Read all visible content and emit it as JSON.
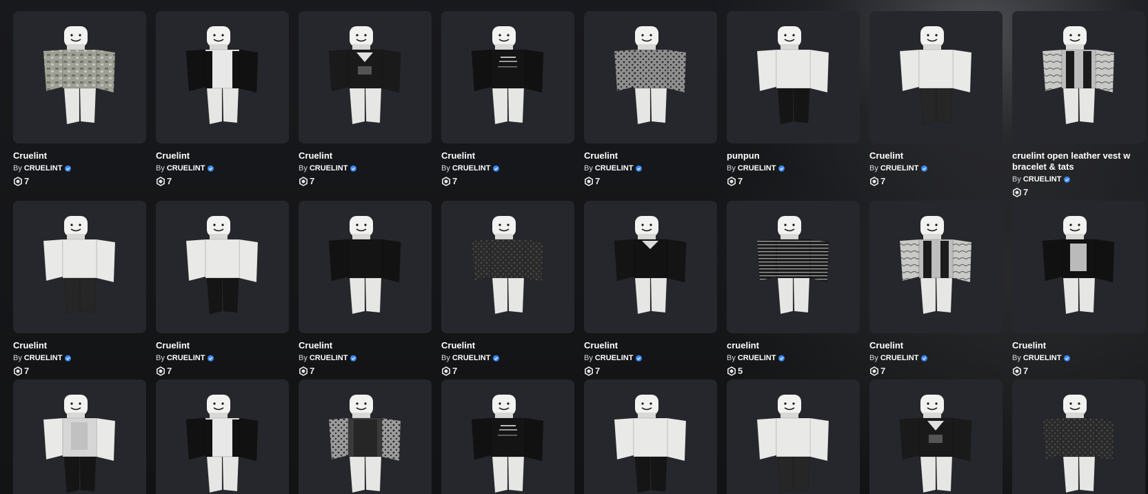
{
  "items": [
    {
      "name": "Cruelint",
      "by": "By",
      "creator": "CRUELINT",
      "price": "7",
      "shirt": "camo",
      "pants": "white"
    },
    {
      "name": "Cruelint",
      "by": "By",
      "creator": "CRUELINT",
      "price": "7",
      "shirt": "black-jacket-white",
      "pants": "white"
    },
    {
      "name": "Cruelint",
      "by": "By",
      "creator": "CRUELINT",
      "price": "7",
      "shirt": "black-graphic",
      "pants": "white"
    },
    {
      "name": "Cruelint",
      "by": "By",
      "creator": "CRUELINT",
      "price": "7",
      "shirt": "black-text",
      "pants": "white"
    },
    {
      "name": "Cruelint",
      "by": "By",
      "creator": "CRUELINT",
      "price": "7",
      "shirt": "leopard",
      "pants": "white"
    },
    {
      "name": "punpun",
      "by": "By",
      "creator": "CRUELINT",
      "price": "7",
      "shirt": "none",
      "pants": "black"
    },
    {
      "name": "Cruelint",
      "by": "By",
      "creator": "CRUELINT",
      "price": "7",
      "shirt": "none",
      "pants": "black-pattern"
    },
    {
      "name": "cruelint open leather vest w bracelet & tats",
      "by": "By",
      "creator": "CRUELINT",
      "price": "7",
      "shirt": "vest-tats",
      "pants": "white"
    },
    {
      "name": "Cruelint",
      "by": "By",
      "creator": "CRUELINT",
      "price": "7",
      "shirt": "none",
      "pants": "black-pattern"
    },
    {
      "name": "Cruelint",
      "by": "By",
      "creator": "CRUELINT",
      "price": "7",
      "shirt": "none",
      "pants": "black"
    },
    {
      "name": "Cruelint",
      "by": "By",
      "creator": "CRUELINT",
      "price": "7",
      "shirt": "black-plain",
      "pants": "white"
    },
    {
      "name": "Cruelint",
      "by": "By",
      "creator": "CRUELINT",
      "price": "7",
      "shirt": "black-leather",
      "pants": "white"
    },
    {
      "name": "Cruelint",
      "by": "By",
      "creator": "CRUELINT",
      "price": "7",
      "shirt": "black-white-sleeve",
      "pants": "white"
    },
    {
      "name": "cruelint",
      "by": "By",
      "creator": "CRUELINT",
      "price": "5",
      "shirt": "stripes",
      "pants": "white"
    },
    {
      "name": "Cruelint",
      "by": "By",
      "creator": "CRUELINT",
      "price": "7",
      "shirt": "grey-vest",
      "pants": "white"
    },
    {
      "name": "Cruelint",
      "by": "By",
      "creator": "CRUELINT",
      "price": "7",
      "shirt": "black-tank",
      "pants": "white"
    },
    {
      "name": "",
      "by": "",
      "creator": "",
      "price": "",
      "shirt": "white-tee",
      "pants": "black"
    },
    {
      "name": "",
      "by": "",
      "creator": "",
      "price": "",
      "shirt": "black-jacket-white",
      "pants": "white"
    },
    {
      "name": "",
      "by": "",
      "creator": "",
      "price": "",
      "shirt": "grey-pattern",
      "pants": "white"
    },
    {
      "name": "",
      "by": "",
      "creator": "",
      "price": "",
      "shirt": "black-text",
      "pants": "white"
    },
    {
      "name": "",
      "by": "",
      "creator": "",
      "price": "",
      "shirt": "none",
      "pants": "black"
    },
    {
      "name": "",
      "by": "",
      "creator": "",
      "price": "",
      "shirt": "none",
      "pants": "black-pattern"
    },
    {
      "name": "",
      "by": "",
      "creator": "",
      "price": "",
      "shirt": "black-graphic",
      "pants": "white"
    },
    {
      "name": "",
      "by": "",
      "creator": "",
      "price": "",
      "shirt": "black-leather",
      "pants": "white"
    }
  ],
  "colors": {
    "background": "#16171a",
    "card": "#26272c",
    "verified": "#3a8cff",
    "text": "#ffffff"
  },
  "icons": {
    "verified": "verified-badge-icon",
    "currency": "robux-icon"
  }
}
